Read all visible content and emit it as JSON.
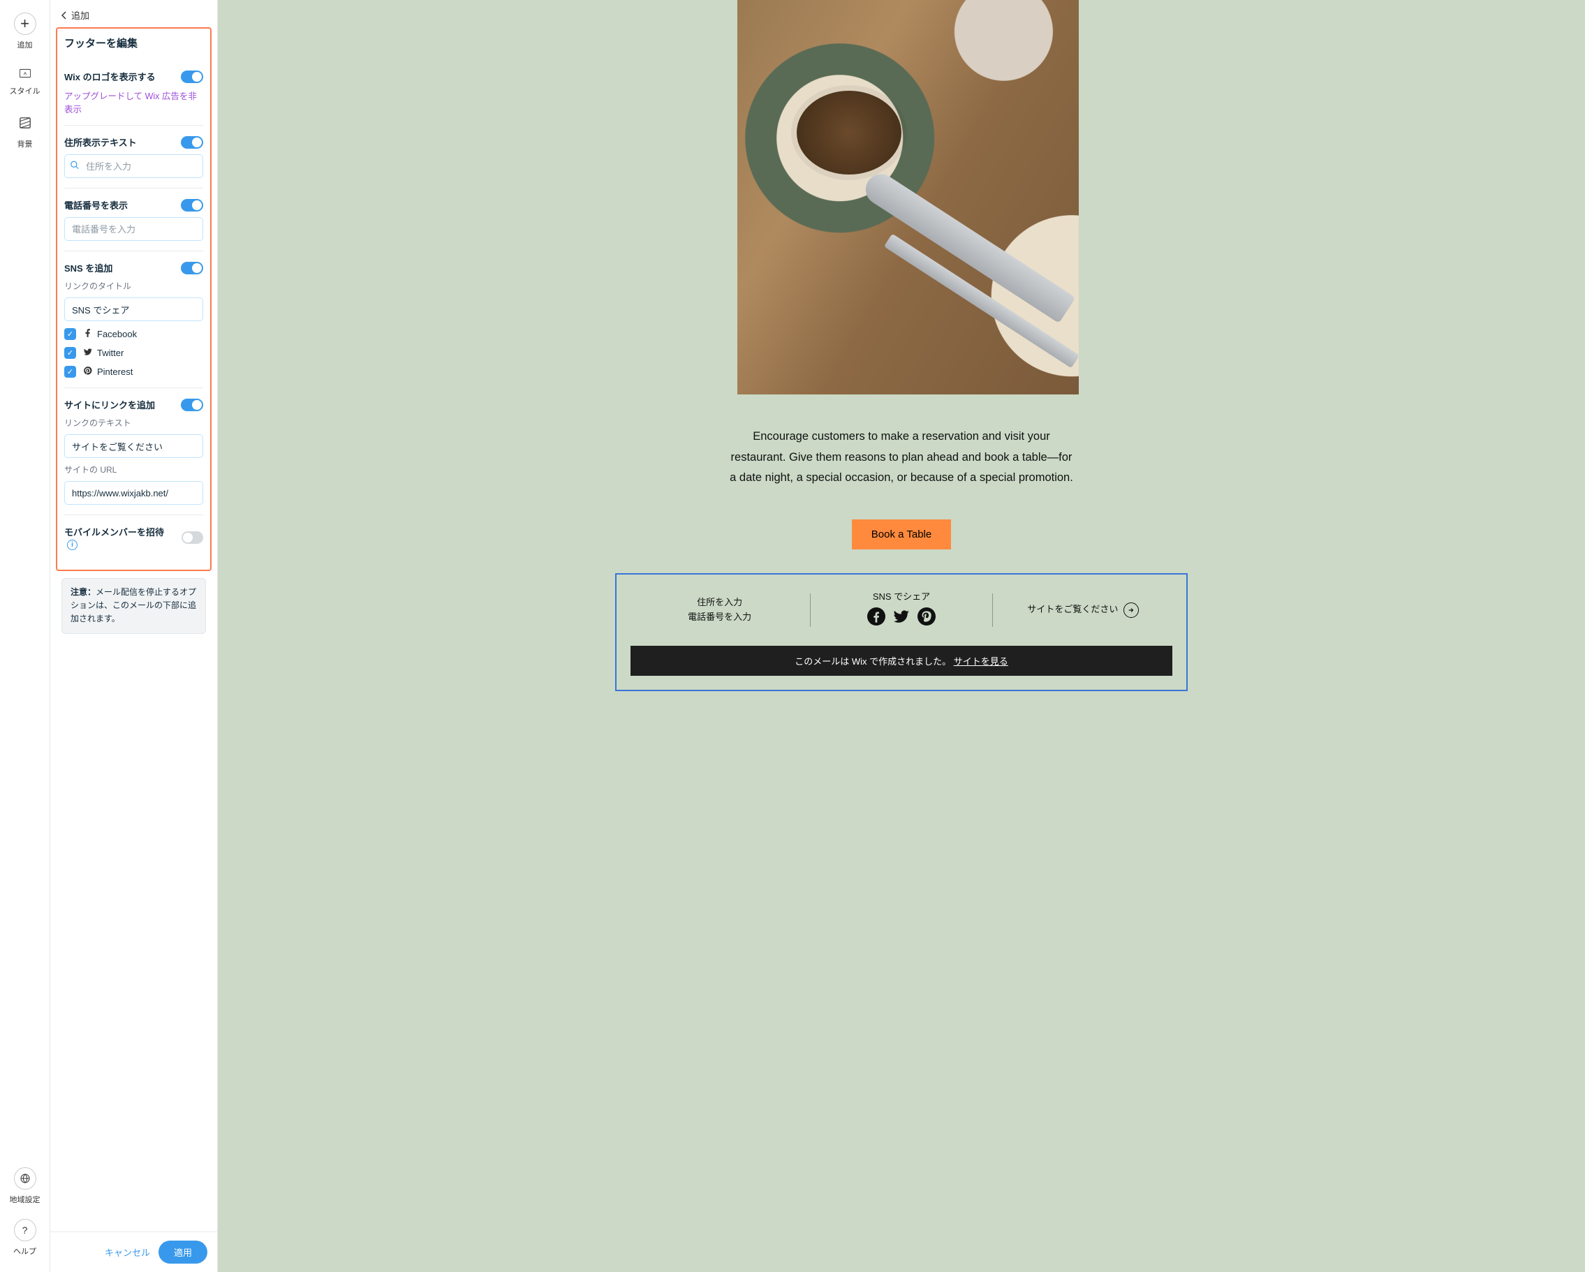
{
  "rail": {
    "add": "追加",
    "style": "スタイル",
    "background": "背景",
    "locale": "地域設定",
    "help": "ヘルプ"
  },
  "panel": {
    "back_label": "追加",
    "title": "フッターを編集",
    "logo": {
      "label": "Wix のロゴを表示する",
      "on": true,
      "upgrade": "アップグレードして Wix 広告を非表示"
    },
    "address": {
      "label": "住所表示テキスト",
      "on": true,
      "placeholder": "住所を入力",
      "value": ""
    },
    "phone": {
      "label": "電話番号を表示",
      "on": true,
      "placeholder": "電話番号を入力",
      "value": ""
    },
    "sns": {
      "label": "SNS を追加",
      "on": true,
      "sub_label": "リンクのタイトル",
      "title_value": "SNS でシェア",
      "options": [
        {
          "name": "Facebook",
          "checked": true
        },
        {
          "name": "Twitter",
          "checked": true
        },
        {
          "name": "Pinterest",
          "checked": true
        }
      ]
    },
    "sitelink": {
      "label": "サイトにリンクを追加",
      "on": true,
      "text_sub_label": "リンクのテキスト",
      "text_value": "サイトをご覧ください",
      "url_sub_label": "サイトの URL",
      "url_value": "https://www.wixjakb.net/"
    },
    "mobile": {
      "label": "モバイルメンバーを招待",
      "on": false
    },
    "note_prefix": "注意：",
    "note_body": "メール配信を停止するオプションは、このメールの下部に追加されます。",
    "cancel": "キャンセル",
    "apply": "適用"
  },
  "preview": {
    "paragraph": "Encourage customers to make a reservation and visit your restaurant. Give them reasons to plan ahead and book a table—for a date night, a special occasion, or because of a special promotion.",
    "cta": "Book a Table",
    "footer": {
      "address_line": "住所を入力",
      "phone_line": "電話番号を入力",
      "sns_title": "SNS でシェア",
      "link_text": "サイトをご覧ください",
      "wix_text": "このメールは Wix で作成されました。",
      "wix_link": "サイトを見る"
    }
  }
}
